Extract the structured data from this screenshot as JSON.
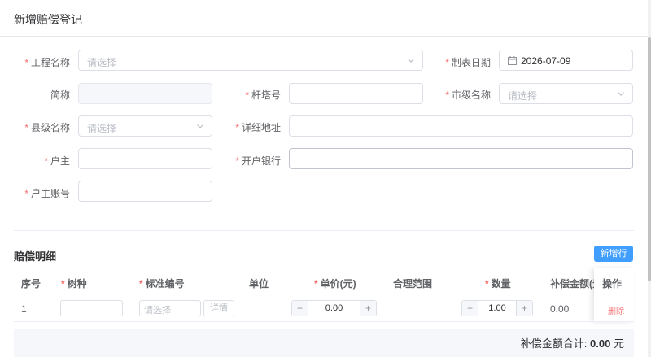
{
  "dialog": {
    "title": "新增赔偿登记"
  },
  "form": {
    "project_name": {
      "label": "工程名称",
      "placeholder": "请选择"
    },
    "date": {
      "label": "制表日期",
      "value": "2026-07-09"
    },
    "short_name": {
      "label": "简称",
      "value": ""
    },
    "tower_no": {
      "label": "杆塔号",
      "value": ""
    },
    "city": {
      "label": "市级名称",
      "placeholder": "请选择"
    },
    "county": {
      "label": "县级名称",
      "placeholder": "请选择"
    },
    "address": {
      "label": "详细地址",
      "value": ""
    },
    "owner": {
      "label": "户主",
      "value": ""
    },
    "bank": {
      "label": "开户银行",
      "value": ""
    },
    "account": {
      "label": "户主账号",
      "value": ""
    }
  },
  "details": {
    "title": "赔偿明细",
    "add_button": "新增行",
    "columns": [
      "序号",
      "树种",
      "标准编号",
      "单位",
      "单价(元)",
      "合理范围",
      "数量",
      "补偿金额(元)",
      "操作"
    ],
    "rows": [
      {
        "index": "1",
        "species": "",
        "standard_placeholder": "请选择",
        "detail_button": "详情",
        "unit": "",
        "price": "0.00",
        "range": "",
        "quantity": "1.00",
        "amount": "0.00",
        "action": "删除"
      }
    ],
    "minus": "−",
    "plus": "+",
    "total_label": "补偿金额合计:",
    "total_value": "0.00",
    "total_unit": "元"
  },
  "required_mark": "*",
  "colors": {
    "primary": "#409eff",
    "danger": "#f56c6c",
    "border": "#dcdfe6",
    "placeholder": "#b8bcc4"
  }
}
